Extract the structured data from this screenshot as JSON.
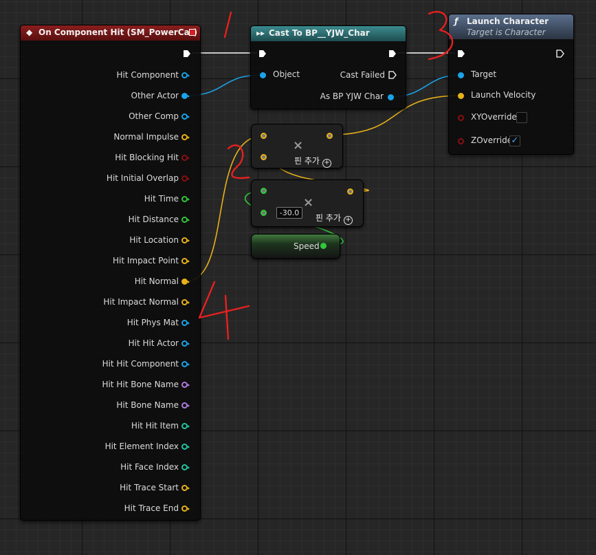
{
  "event_node": {
    "title": "On Component Hit (SM_PowerCar)",
    "pins": [
      {
        "label": "Hit Component",
        "color": "#1aa3e8"
      },
      {
        "label": "Other Actor",
        "color": "#1aa3e8",
        "connected": true
      },
      {
        "label": "Other Comp",
        "color": "#1aa3e8"
      },
      {
        "label": "Normal Impulse",
        "color": "#e8b21a"
      },
      {
        "label": "Hit Blocking Hit",
        "color": "#8a0f0f"
      },
      {
        "label": "Hit Initial Overlap",
        "color": "#8a0f0f"
      },
      {
        "label": "Hit Time",
        "color": "#31c93b"
      },
      {
        "label": "Hit Distance",
        "color": "#31c93b"
      },
      {
        "label": "Hit Location",
        "color": "#e8b21a"
      },
      {
        "label": "Hit Impact Point",
        "color": "#e8b21a"
      },
      {
        "label": "Hit Normal",
        "color": "#e8b21a",
        "connected": true
      },
      {
        "label": "Hit Impact Normal",
        "color": "#e8b21a"
      },
      {
        "label": "Hit Phys Mat",
        "color": "#1aa3e8"
      },
      {
        "label": "Hit Hit Actor",
        "color": "#1aa3e8"
      },
      {
        "label": "Hit Hit Component",
        "color": "#1aa3e8"
      },
      {
        "label": "Hit Hit Bone Name",
        "color": "#b07ae0"
      },
      {
        "label": "Hit Bone Name",
        "color": "#b07ae0"
      },
      {
        "label": "Hit Hit Item",
        "color": "#20c4a0"
      },
      {
        "label": "Hit Element Index",
        "color": "#20c4a0"
      },
      {
        "label": "Hit Face Index",
        "color": "#20c4a0"
      },
      {
        "label": "Hit Trace Start",
        "color": "#e8b21a"
      },
      {
        "label": "Hit Trace End",
        "color": "#e8b21a"
      }
    ]
  },
  "cast_node": {
    "title": "Cast To BP__YJW_Char",
    "object_label": "Object",
    "cast_failed_label": "Cast Failed",
    "as_label": "As BP  YJW Char"
  },
  "launch_node": {
    "title": "Launch Character",
    "subtitle": "Target is Character",
    "target_label": "Target",
    "velocity_label": "Launch Velocity",
    "xy_override_label": "XYOverride",
    "xy_override_checked": false,
    "z_override_label": "ZOverride",
    "z_override_checked": true,
    "check_mark": "✓"
  },
  "multiply_vector": {
    "add_pin_label": "핀 추가"
  },
  "multiply_float": {
    "add_pin_label": "핀 추가",
    "value": "-30.0"
  },
  "speed_var": {
    "label": "Speed"
  },
  "annotations": [
    "1",
    "2",
    "3",
    "4"
  ],
  "colors": {
    "exec": "#ffffff",
    "object": "#1aa3e8",
    "vector": "#e8b21a",
    "float": "#31c93b",
    "bool": "#8a0f0f"
  }
}
